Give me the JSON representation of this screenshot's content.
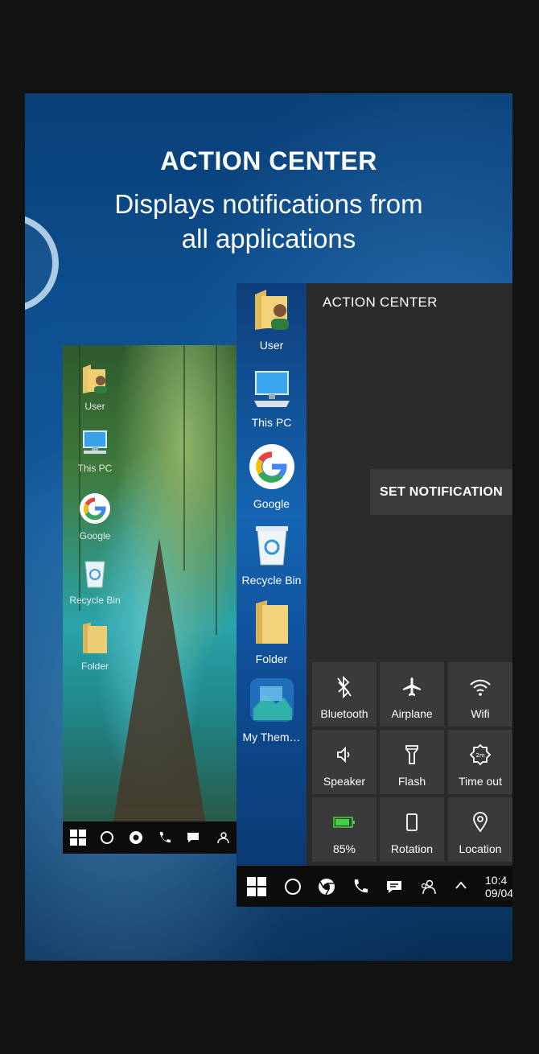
{
  "promo": {
    "title": "ACTION CENTER",
    "subtitle_line1": "Displays notifications from",
    "subtitle_line2": "all applications"
  },
  "back_phone": {
    "icons": [
      {
        "label": "User",
        "icon": "user-folder-icon"
      },
      {
        "label": "This PC",
        "icon": "computer-icon"
      },
      {
        "label": "Google",
        "icon": "google-icon"
      },
      {
        "label": "Recycle Bin",
        "icon": "recycle-bin-icon"
      },
      {
        "label": "Folder",
        "icon": "folder-icon"
      }
    ]
  },
  "front_phone": {
    "apps": [
      {
        "label": "User",
        "icon": "user-folder-icon"
      },
      {
        "label": "This PC",
        "icon": "computer-icon"
      },
      {
        "label": "Google",
        "icon": "google-icon"
      },
      {
        "label": "Recycle Bin",
        "icon": "recycle-bin-icon"
      },
      {
        "label": "Folder",
        "icon": "folder-icon"
      },
      {
        "label": "My Them…",
        "icon": "themes-icon"
      }
    ],
    "action_center": {
      "title": "ACTION CENTER",
      "set_notification": "SET NOTIFICATION"
    },
    "tiles": [
      {
        "label": "Bluetooth",
        "icon": "bluetooth-icon"
      },
      {
        "label": "Airplane",
        "icon": "airplane-icon"
      },
      {
        "label": "Wifi",
        "icon": "wifi-icon"
      },
      {
        "label": "Speaker",
        "icon": "speaker-icon"
      },
      {
        "label": "Flash",
        "icon": "flashlight-icon"
      },
      {
        "label": "Time out",
        "icon": "timeout-icon"
      },
      {
        "label": "85%",
        "icon": "battery-icon"
      },
      {
        "label": "Rotation",
        "icon": "rotation-icon"
      },
      {
        "label": "Location",
        "icon": "location-icon"
      }
    ],
    "clock": {
      "time": "10:4",
      "date": "09/04"
    }
  },
  "colors": {
    "accent_blue": "#0b4e8e",
    "panel": "#2b2b2b",
    "tile": "#3a3a3a",
    "battery_green": "#3fd43f"
  }
}
